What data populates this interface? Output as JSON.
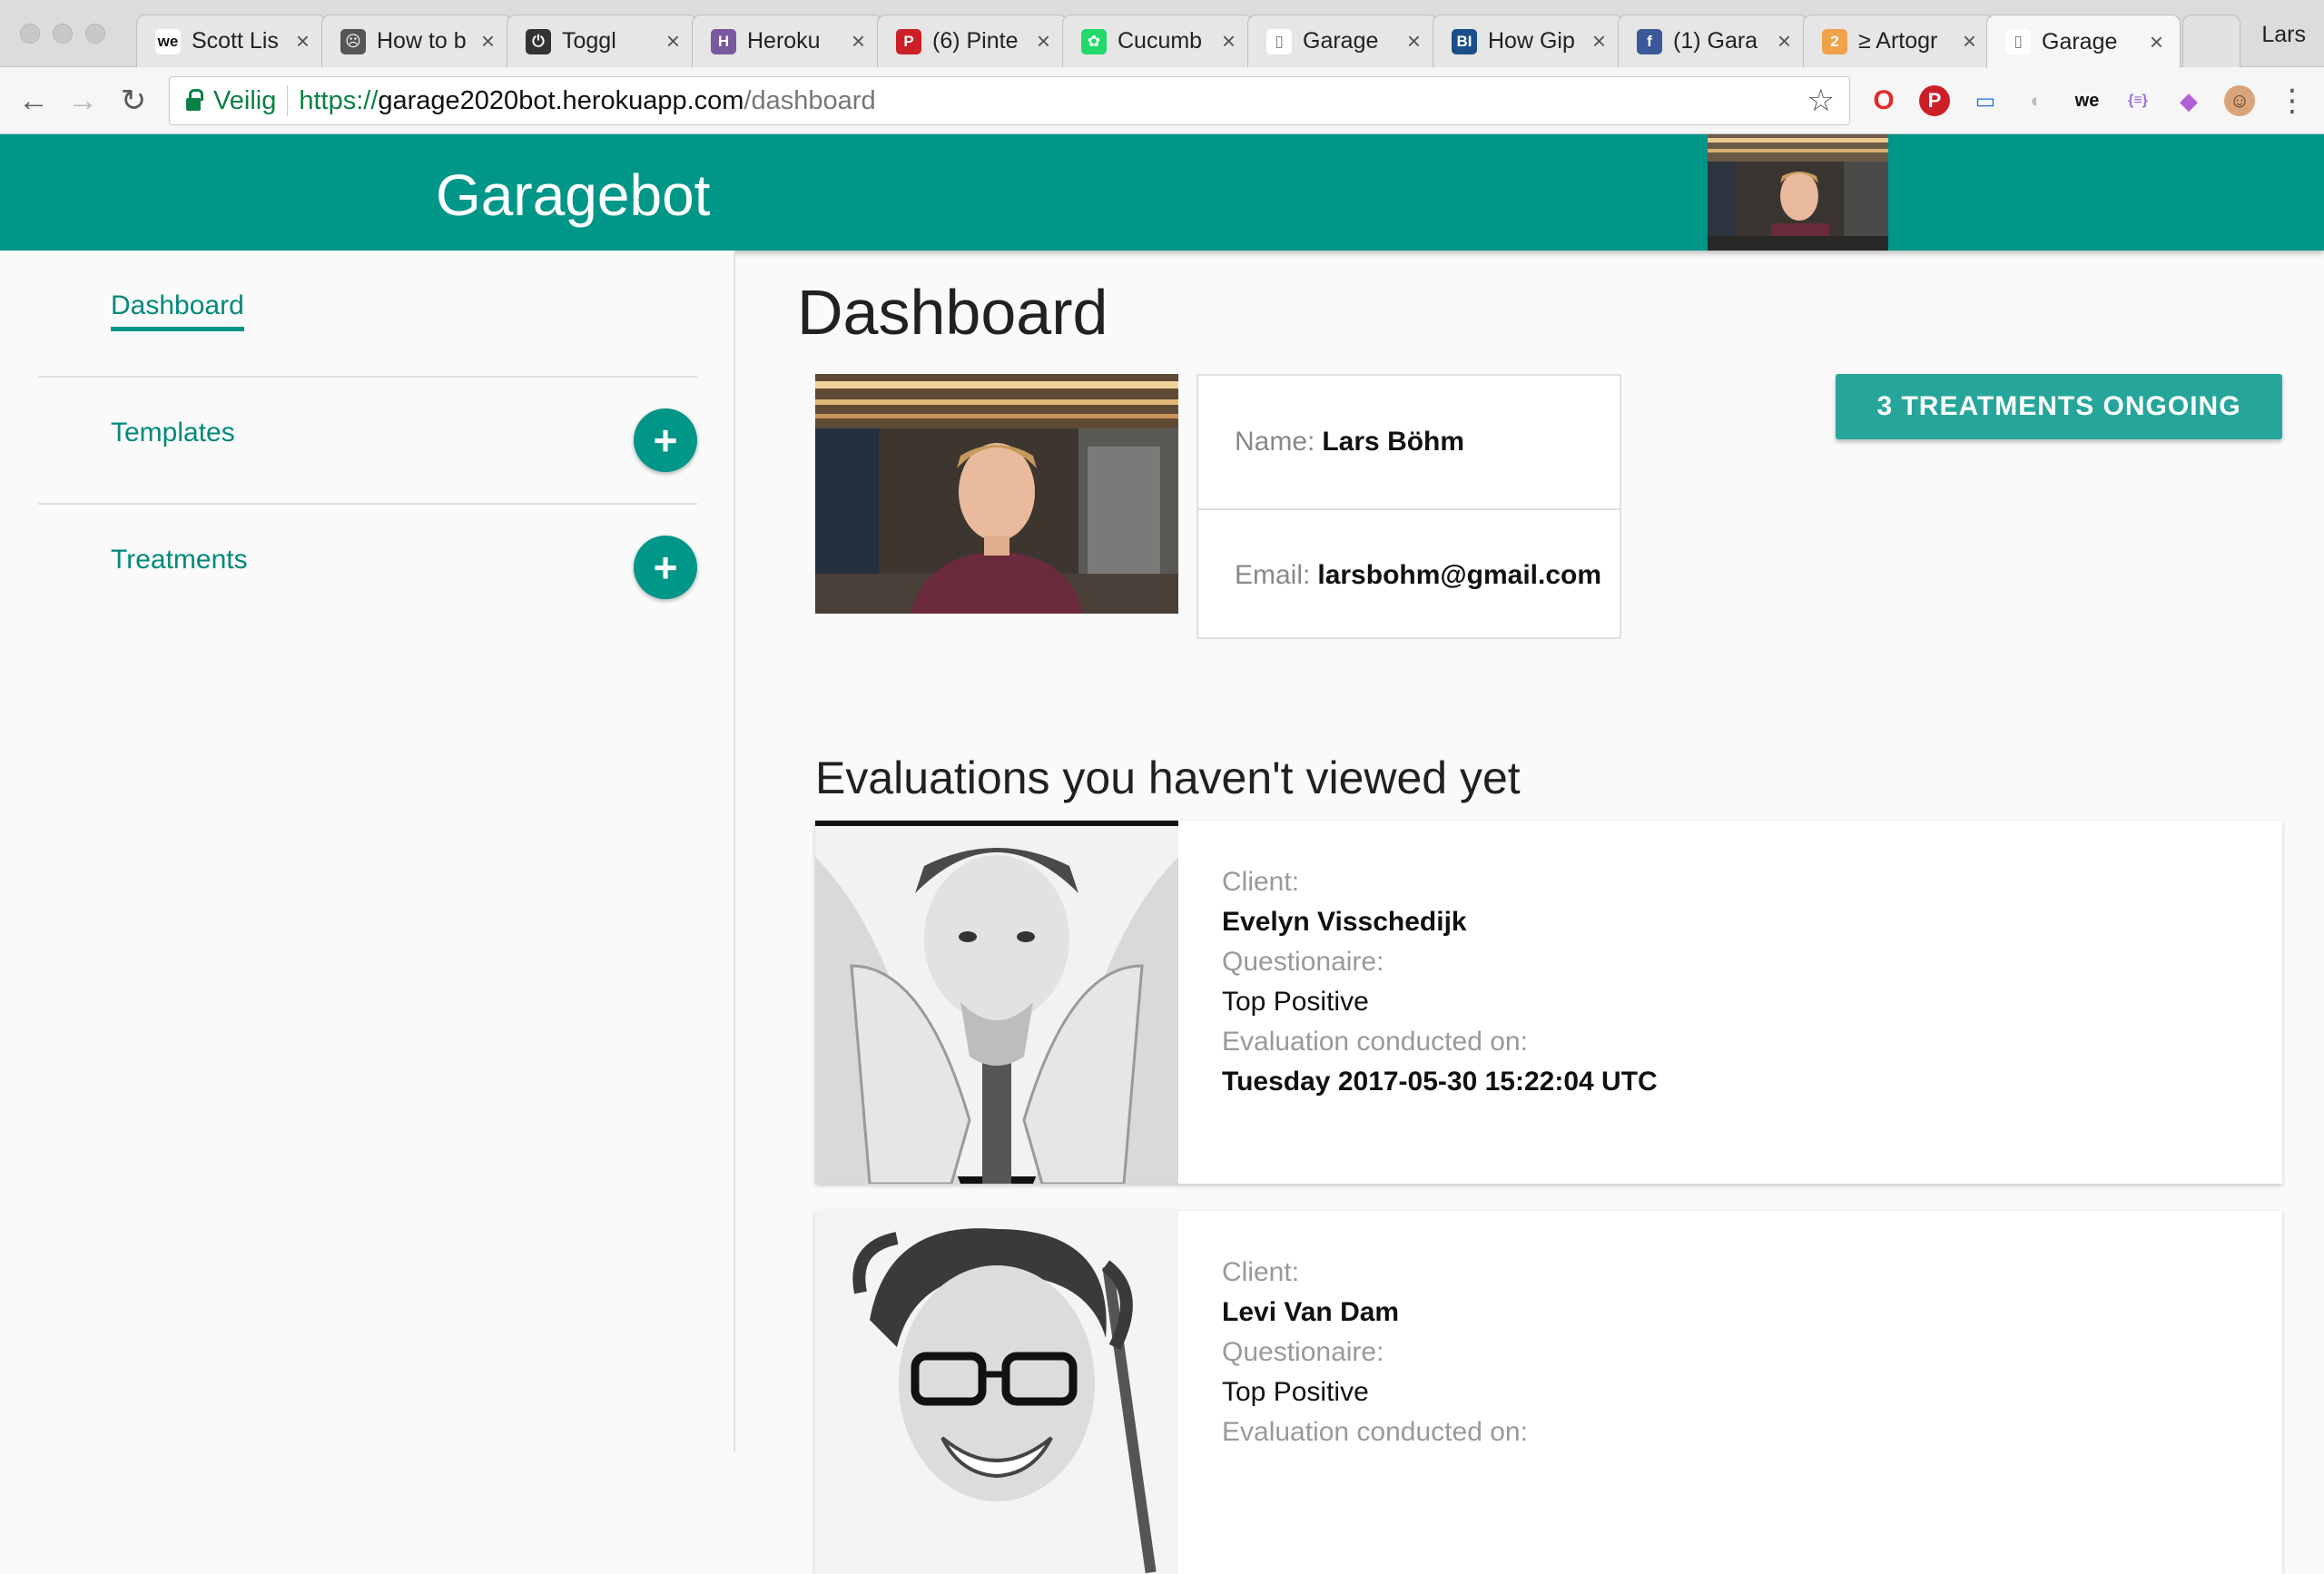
{
  "browser": {
    "tabs": [
      {
        "label": "Scott Lis",
        "icon": "we-icon",
        "color": "#ffffff",
        "fg": "#111111",
        "glyph": "we"
      },
      {
        "label": "How to b",
        "icon": "folder-icon",
        "color": "#555555",
        "fg": "#ffffff",
        "glyph": "☹"
      },
      {
        "label": "Toggl",
        "icon": "power-icon",
        "color": "#333333",
        "fg": "#ffffff",
        "glyph": "⏻"
      },
      {
        "label": "Heroku",
        "icon": "heroku-icon",
        "color": "#79589f",
        "fg": "#ffffff",
        "glyph": "H"
      },
      {
        "label": "(6) Pinte",
        "icon": "pinterest-icon",
        "color": "#cb2027",
        "fg": "#ffffff",
        "glyph": "P"
      },
      {
        "label": "Cucumb",
        "icon": "cucumber-icon",
        "color": "#23d96c",
        "fg": "#ffffff",
        "glyph": "✿"
      },
      {
        "label": "Garage",
        "icon": "page-icon",
        "color": "#ffffff",
        "fg": "#777777",
        "glyph": "▯"
      },
      {
        "label": "How Gip",
        "icon": "bi-icon",
        "color": "#1b4f8a",
        "fg": "#ffffff",
        "glyph": "BI"
      },
      {
        "label": "(1) Gara",
        "icon": "facebook-icon",
        "color": "#3b5998",
        "fg": "#ffffff",
        "glyph": "f"
      },
      {
        "label": "≥ Artogr",
        "icon": "badge-icon",
        "color": "#f0a24b",
        "fg": "#ffffff",
        "glyph": "2"
      },
      {
        "label": "Garage",
        "icon": "page-icon",
        "color": "#ffffff",
        "fg": "#777777",
        "glyph": "▯"
      }
    ],
    "profile_name": "Lars",
    "secure_label": "Veilig",
    "url_scheme": "https://",
    "url_host": "garage2020bot.herokuapp.com",
    "url_path": "/dashboard"
  },
  "app": {
    "brand": "Garagebot"
  },
  "sidebar": {
    "items": [
      {
        "label": "Dashboard",
        "has_add": false,
        "active": true
      },
      {
        "label": "Templates",
        "has_add": true,
        "active": false
      },
      {
        "label": "Treatments",
        "has_add": true,
        "active": false
      }
    ],
    "add_glyph": "+"
  },
  "dashboard": {
    "title": "Dashboard",
    "name_key": "Name:",
    "name_value": "Lars Böhm",
    "email_key": "Email:",
    "email_value": "larsbohm@gmail.com",
    "treatments_button": "3 TREATMENTS ONGOING",
    "evaluations_title": "Evaluations you haven't viewed yet"
  },
  "evaluations": [
    {
      "client_key": "Client:",
      "client": "Evelyn Visschedijk",
      "questionnaire_key": "Questionaire:",
      "questionnaire": "Top Positive",
      "date_key": "Evaluation conducted on:",
      "date": "Tuesday 2017-05-30 15:22:04 UTC"
    },
    {
      "client_key": "Client:",
      "client": "Levi Van Dam",
      "questionnaire_key": "Questionaire:",
      "questionnaire": "Top Positive",
      "date_key": "Evaluation conducted on:",
      "date": ""
    }
  ]
}
